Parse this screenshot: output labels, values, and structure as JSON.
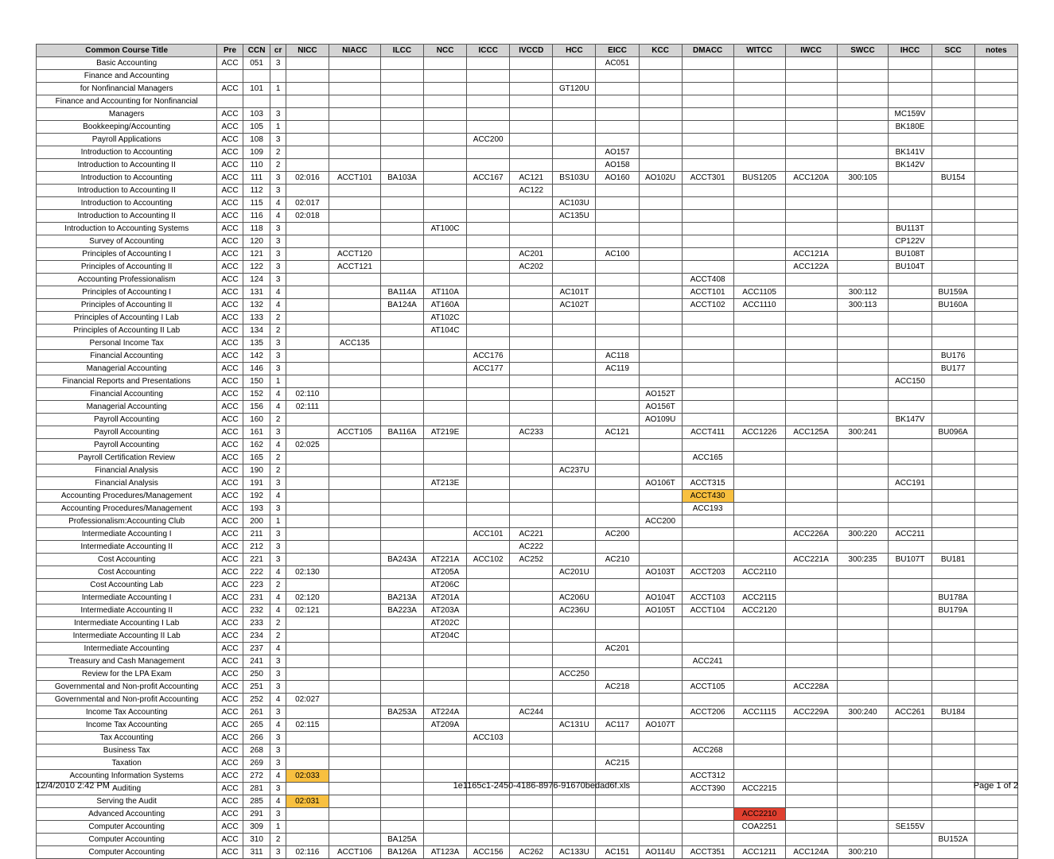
{
  "footer": {
    "date": "12/4/2010 2:42 PM",
    "file": "1e1165c1-2450-4186-8976-91670bedad6f.xls",
    "page": "Page 1 of 2"
  },
  "headers": [
    "Common Course Title",
    "Pre",
    "CCN",
    "cr",
    "NICC",
    "NIACC",
    "ILCC",
    "NCC",
    "ICCC",
    "IVCCD",
    "HCC",
    "EICC",
    "KCC",
    "DMACC",
    "WITCC",
    "IWCC",
    "SWCC",
    "IHCC",
    "SCC",
    "notes"
  ],
  "rows": [
    {
      "title": "Basic Accounting",
      "pre": "ACC",
      "ccn": "051",
      "cr": "3",
      "EICC": "AC051"
    },
    {
      "title": "Finance and Accounting"
    },
    {
      "title": "for Nonfinancial Managers",
      "pre": "ACC",
      "ccn": "101",
      "cr": "1",
      "HCC": "GT120U"
    },
    {
      "title": "Finance and Accounting for Nonfinancial"
    },
    {
      "title": "Managers",
      "pre": "ACC",
      "ccn": "103",
      "cr": "3",
      "IHCC": "MC159V"
    },
    {
      "title": "Bookkeeping/Accounting",
      "pre": "ACC",
      "ccn": "105",
      "cr": "1",
      "IHCC": "BK180E"
    },
    {
      "title": "Payroll Applications",
      "pre": "ACC",
      "ccn": "108",
      "cr": "3",
      "ICCC": "ACC200"
    },
    {
      "title": "Introduction to Accounting",
      "pre": "ACC",
      "ccn": "109",
      "cr": "2",
      "EICC": "AO157",
      "IHCC": "BK141V"
    },
    {
      "title": "Introduction to Accounting II",
      "pre": "ACC",
      "ccn": "110",
      "cr": "2",
      "EICC": "AO158",
      "IHCC": "BK142V"
    },
    {
      "title": "Introduction to Accounting",
      "pre": "ACC",
      "ccn": "111",
      "cr": "3",
      "NICC": "02:016",
      "NIACC": "ACCT101",
      "ILCC": "BA103A",
      "ICCC": "ACC167",
      "IVCCD": "AC121",
      "HCC": "BS103U",
      "EICC": "AO160",
      "KCC": "AO102U",
      "DMACC": "ACCT301",
      "WITCC": "BUS1205",
      "IWCC": "ACC120A",
      "SWCC": "300:105",
      "SCC": "BU154"
    },
    {
      "title": "Introduction to Accounting II",
      "pre": "ACC",
      "ccn": "112",
      "cr": "3",
      "IVCCD": "AC122"
    },
    {
      "title": "Introduction to Accounting",
      "pre": "ACC",
      "ccn": "115",
      "cr": "4",
      "NICC": "02:017",
      "HCC": "AC103U"
    },
    {
      "title": "Introduction to Accounting II",
      "pre": "ACC",
      "ccn": "116",
      "cr": "4",
      "NICC": "02:018",
      "HCC": "AC135U"
    },
    {
      "title": "Introduction to Accounting Systems",
      "pre": "ACC",
      "ccn": "118",
      "cr": "3",
      "NCC": "AT100C",
      "IHCC": "BU113T"
    },
    {
      "title": "Survey of Accounting",
      "pre": "ACC",
      "ccn": "120",
      "cr": "3",
      "IHCC": "CP122V"
    },
    {
      "title": "Principles of Accounting I",
      "pre": "ACC",
      "ccn": "121",
      "cr": "3",
      "NIACC": "ACCT120",
      "IVCCD": "AC201",
      "EICC": "AC100",
      "IWCC": "ACC121A",
      "IHCC": "BU108T"
    },
    {
      "title": "Principles of Accounting II",
      "pre": "ACC",
      "ccn": "122",
      "cr": "3",
      "NIACC": "ACCT121",
      "IVCCD": "AC202",
      "IWCC": "ACC122A",
      "IHCC": "BU104T"
    },
    {
      "title": "Accounting Professionalism",
      "pre": "ACC",
      "ccn": "124",
      "cr": "3",
      "DMACC": "ACCT408"
    },
    {
      "title": "Principles of Accounting I",
      "pre": "ACC",
      "ccn": "131",
      "cr": "4",
      "ILCC": "BA114A",
      "NCC": "AT110A",
      "HCC": "AC101T",
      "DMACC": "ACCT101",
      "WITCC": "ACC1105",
      "SWCC": "300:112",
      "SCC": "BU159A"
    },
    {
      "title": "Principles of Accounting II",
      "pre": "ACC",
      "ccn": "132",
      "cr": "4",
      "ILCC": "BA124A",
      "NCC": "AT160A",
      "HCC": "AC102T",
      "DMACC": "ACCT102",
      "WITCC": "ACC1110",
      "SWCC": "300:113",
      "SCC": "BU160A"
    },
    {
      "title": "Principles of Accounting I Lab",
      "pre": "ACC",
      "ccn": "133",
      "cr": "2",
      "NCC": "AT102C"
    },
    {
      "title": "Principles of Accounting II Lab",
      "pre": "ACC",
      "ccn": "134",
      "cr": "2",
      "NCC": "AT104C"
    },
    {
      "title": "Personal Income Tax",
      "pre": "ACC",
      "ccn": "135",
      "cr": "3",
      "NIACC": "ACC135"
    },
    {
      "title": "Financial Accounting",
      "pre": "ACC",
      "ccn": "142",
      "cr": "3",
      "ICCC": "ACC176",
      "EICC": "AC118",
      "SCC": "BU176"
    },
    {
      "title": "Managerial Accounting",
      "pre": "ACC",
      "ccn": "146",
      "cr": "3",
      "ICCC": "ACC177",
      "EICC": "AC119",
      "SCC": "BU177"
    },
    {
      "title": "Financial Reports and Presentations",
      "pre": "ACC",
      "ccn": "150",
      "cr": "1",
      "IHCC": "ACC150"
    },
    {
      "title": "Financial Accounting",
      "pre": "ACC",
      "ccn": "152",
      "cr": "4",
      "NICC": "02:110",
      "KCC": "AO152T"
    },
    {
      "title": "Managerial Accounting",
      "pre": "ACC",
      "ccn": "156",
      "cr": "4",
      "NICC": "02:111",
      "KCC": "AO156T"
    },
    {
      "title": "Payroll Accounting",
      "pre": "ACC",
      "ccn": "160",
      "cr": "2",
      "KCC": "AO109U",
      "IHCC": "BK147V"
    },
    {
      "title": "Payroll Accounting",
      "pre": "ACC",
      "ccn": "161",
      "cr": "3",
      "NIACC": "ACCT105",
      "ILCC": "BA116A",
      "NCC": "AT219E",
      "IVCCD": "AC233",
      "EICC": "AC121",
      "DMACC": "ACCT411",
      "WITCC": "ACC1226",
      "IWCC": "ACC125A",
      "SWCC": "300:241",
      "SCC": "BU096A"
    },
    {
      "title": "Payroll Accounting",
      "pre": "ACC",
      "ccn": "162",
      "cr": "4",
      "NICC": "02:025"
    },
    {
      "title": "Payroll Certification Review",
      "pre": "ACC",
      "ccn": "165",
      "cr": "2",
      "DMACC": "ACC165"
    },
    {
      "title": "Financial Analysis",
      "pre": "ACC",
      "ccn": "190",
      "cr": "2",
      "HCC": "AC237U"
    },
    {
      "title": "Financial Analysis",
      "pre": "ACC",
      "ccn": "191",
      "cr": "3",
      "NCC": "AT213E",
      "KCC": "AO106T",
      "DMACC": "ACCT315",
      "IHCC": "ACC191"
    },
    {
      "title": "Accounting Procedures/Management",
      "pre": "ACC",
      "ccn": "192",
      "cr": "4",
      "DMACC": "ACCT430",
      "DMACC_hl": true
    },
    {
      "title": "Accounting Procedures/Management",
      "pre": "ACC",
      "ccn": "193",
      "cr": "3",
      "DMACC": "ACC193"
    },
    {
      "title": "Professionalism:Accounting Club",
      "pre": "ACC",
      "ccn": "200",
      "cr": "1",
      "KCC": "ACC200"
    },
    {
      "title": "Intermediate Accounting I",
      "pre": "ACC",
      "ccn": "211",
      "cr": "3",
      "ICCC": "ACC101",
      "IVCCD": "AC221",
      "EICC": "AC200",
      "IWCC": "ACC226A",
      "SWCC": "300:220",
      "IHCC": "ACC211"
    },
    {
      "title": "Intermediate Accounting II",
      "pre": "ACC",
      "ccn": "212",
      "cr": "3",
      "IVCCD": "AC222"
    },
    {
      "title": "Cost Accounting",
      "pre": "ACC",
      "ccn": "221",
      "cr": "3",
      "ILCC": "BA243A",
      "NCC": "AT221A",
      "ICCC": "ACC102",
      "IVCCD": "AC252",
      "EICC": "AC210",
      "IWCC": "ACC221A",
      "SWCC": "300:235",
      "IHCC": "BU107T",
      "SCC": "BU181"
    },
    {
      "title": "Cost Accounting",
      "pre": "ACC",
      "ccn": "222",
      "cr": "4",
      "NICC": "02:130",
      "NCC": "AT205A",
      "HCC": "AC201U",
      "KCC": "AO103T",
      "DMACC": "ACCT203",
      "WITCC": "ACC2110"
    },
    {
      "title": "Cost Accounting Lab",
      "pre": "ACC",
      "ccn": "223",
      "cr": "2",
      "NCC": "AT206C"
    },
    {
      "title": "Intermediate Accounting I",
      "pre": "ACC",
      "ccn": "231",
      "cr": "4",
      "NICC": "02:120",
      "ILCC": "BA213A",
      "NCC": "AT201A",
      "HCC": "AC206U",
      "KCC": "AO104T",
      "DMACC": "ACCT103",
      "WITCC": "ACC2115",
      "SCC": "BU178A"
    },
    {
      "title": "Intermediate Accounting II",
      "pre": "ACC",
      "ccn": "232",
      "cr": "4",
      "NICC": "02:121",
      "ILCC": "BA223A",
      "NCC": "AT203A",
      "HCC": "AC236U",
      "KCC": "AO105T",
      "DMACC": "ACCT104",
      "WITCC": "ACC2120",
      "SCC": "BU179A"
    },
    {
      "title": "Intermediate Accounting I Lab",
      "pre": "ACC",
      "ccn": "233",
      "cr": "2",
      "NCC": "AT202C"
    },
    {
      "title": "Intermediate Accounting II Lab",
      "pre": "ACC",
      "ccn": "234",
      "cr": "2",
      "NCC": "AT204C"
    },
    {
      "title": "Intermediate Accounting",
      "pre": "ACC",
      "ccn": "237",
      "cr": "4",
      "EICC": "AC201"
    },
    {
      "title": "Treasury and Cash Management",
      "pre": "ACC",
      "ccn": "241",
      "cr": "3",
      "DMACC": "ACC241"
    },
    {
      "title": "Review for the LPA Exam",
      "pre": "ACC",
      "ccn": "250",
      "cr": "3",
      "HCC": "ACC250"
    },
    {
      "title": "Governmental and Non-profit Accounting",
      "pre": "ACC",
      "ccn": "251",
      "cr": "3",
      "EICC": "AC218",
      "DMACC": "ACCT105",
      "IWCC": "ACC228A"
    },
    {
      "title": "Governmental and Non-profit Accounting",
      "pre": "ACC",
      "ccn": "252",
      "cr": "4",
      "NICC": "02:027"
    },
    {
      "title": "Income Tax Accounting",
      "pre": "ACC",
      "ccn": "261",
      "cr": "3",
      "ILCC": "BA253A",
      "NCC": "AT224A",
      "IVCCD": "AC244",
      "DMACC": "ACCT206",
      "WITCC": "ACC1115",
      "IWCC": "ACC229A",
      "SWCC": "300:240",
      "IHCC": "ACC261",
      "SCC": "BU184"
    },
    {
      "title": "Income Tax Accounting",
      "pre": "ACC",
      "ccn": "265",
      "cr": "4",
      "NICC": "02:115",
      "NCC": "AT209A",
      "HCC": "AC131U",
      "EICC": "AC117",
      "KCC": "AO107T"
    },
    {
      "title": "Tax Accounting",
      "pre": "ACC",
      "ccn": "266",
      "cr": "3",
      "ICCC": "ACC103"
    },
    {
      "title": "Business Tax",
      "pre": "ACC",
      "ccn": "268",
      "cr": "3",
      "DMACC": "ACC268"
    },
    {
      "title": "Taxation",
      "pre": "ACC",
      "ccn": "269",
      "cr": "3",
      "EICC": "AC215"
    },
    {
      "title": "Accounting Information Systems",
      "pre": "ACC",
      "ccn": "272",
      "cr": "4",
      "NICC": "02:033",
      "NICC_hl": true,
      "DMACC": "ACCT312"
    },
    {
      "title": "Auditing",
      "pre": "ACC",
      "ccn": "281",
      "cr": "3",
      "DMACC": "ACCT390",
      "WITCC": "ACC2215"
    },
    {
      "title": "Serving the Audit",
      "pre": "ACC",
      "ccn": "285",
      "cr": "4",
      "NICC": "02:031",
      "NICC_hl": true
    },
    {
      "title": "Advanced Accounting",
      "pre": "ACC",
      "ccn": "291",
      "cr": "3",
      "WITCC": "ACC2210",
      "WITCC_red": true
    },
    {
      "title": "Computer Accounting",
      "pre": "ACC",
      "ccn": "309",
      "cr": "1",
      "WITCC": "COA2251",
      "IHCC": "SE155V"
    },
    {
      "title": "Computer Accounting",
      "pre": "ACC",
      "ccn": "310",
      "cr": "2",
      "ILCC": "BA125A",
      "SCC": "BU152A"
    },
    {
      "title": "Computer Accounting",
      "pre": "ACC",
      "ccn": "311",
      "cr": "3",
      "NICC": "02:116",
      "NIACC": "ACCT106",
      "ILCC": "BA126A",
      "NCC": "AT123A",
      "ICCC": "ACC156",
      "IVCCD": "AC262",
      "HCC": "AC133U",
      "EICC": "AC151",
      "KCC": "AO114U",
      "DMACC": "ACCT351",
      "WITCC": "ACC1211",
      "IWCC": "ACC124A",
      "SWCC": "300:210"
    }
  ]
}
